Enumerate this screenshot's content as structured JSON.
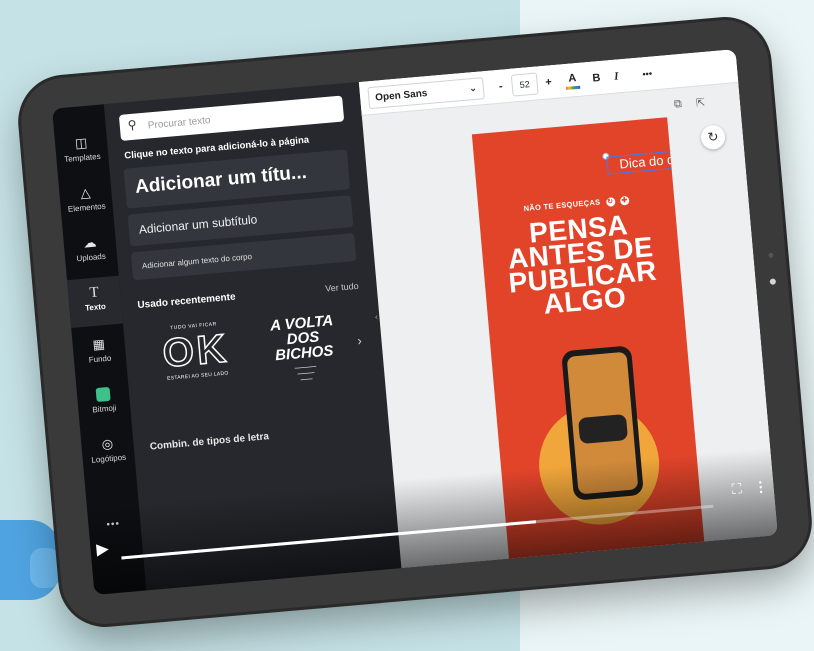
{
  "rail": {
    "items": [
      {
        "label": "Templates",
        "icon": "templates-icon"
      },
      {
        "label": "Elementos",
        "icon": "elements-icon"
      },
      {
        "label": "Uploads",
        "icon": "upload-icon"
      },
      {
        "label": "Texto",
        "icon": "text-icon"
      },
      {
        "label": "Fundo",
        "icon": "background-icon"
      },
      {
        "label": "Bitmoji",
        "icon": "bitmoji-icon"
      },
      {
        "label": "Logótipos",
        "icon": "logo-icon"
      }
    ],
    "more": "•••"
  },
  "panel": {
    "search_placeholder": "Procurar texto",
    "hint": "Clique no texto para adicioná-lo à página",
    "add_title": "Adicionar um títu...",
    "add_subtitle": "Adicionar um subtítulo",
    "add_body": "Adicionar algum texto do corpo",
    "recent_heading": "Usado recentemente",
    "see_all": "Ver tudo",
    "ok_card": {
      "top": "TUDO VAI FICAR",
      "big": "OK",
      "bottom": "ESTAREI AO SEU LADO"
    },
    "volta_card": {
      "title": "A VOLTA DOS BICHOS"
    },
    "combos": "Combin. de tipos de letra"
  },
  "toolbar": {
    "font": "Open Sans",
    "minus": "-",
    "size": "52",
    "plus": "+",
    "color_letter": "A",
    "bold": "B",
    "italic": "I",
    "more": "•••"
  },
  "design": {
    "selected_text": "Dica do dia",
    "subhead": "NÃO TE ESQUEÇAS",
    "headline_lines": [
      "PENSA",
      "ANTES DE",
      "PUBLICAR",
      "ALGO"
    ]
  },
  "video": {
    "progress": 0.7
  },
  "colors": {
    "design_bg": "#e2442a",
    "panel_bg": "#26282d",
    "rail_bg": "#0e0f12",
    "selection": "#3d7bf5"
  }
}
